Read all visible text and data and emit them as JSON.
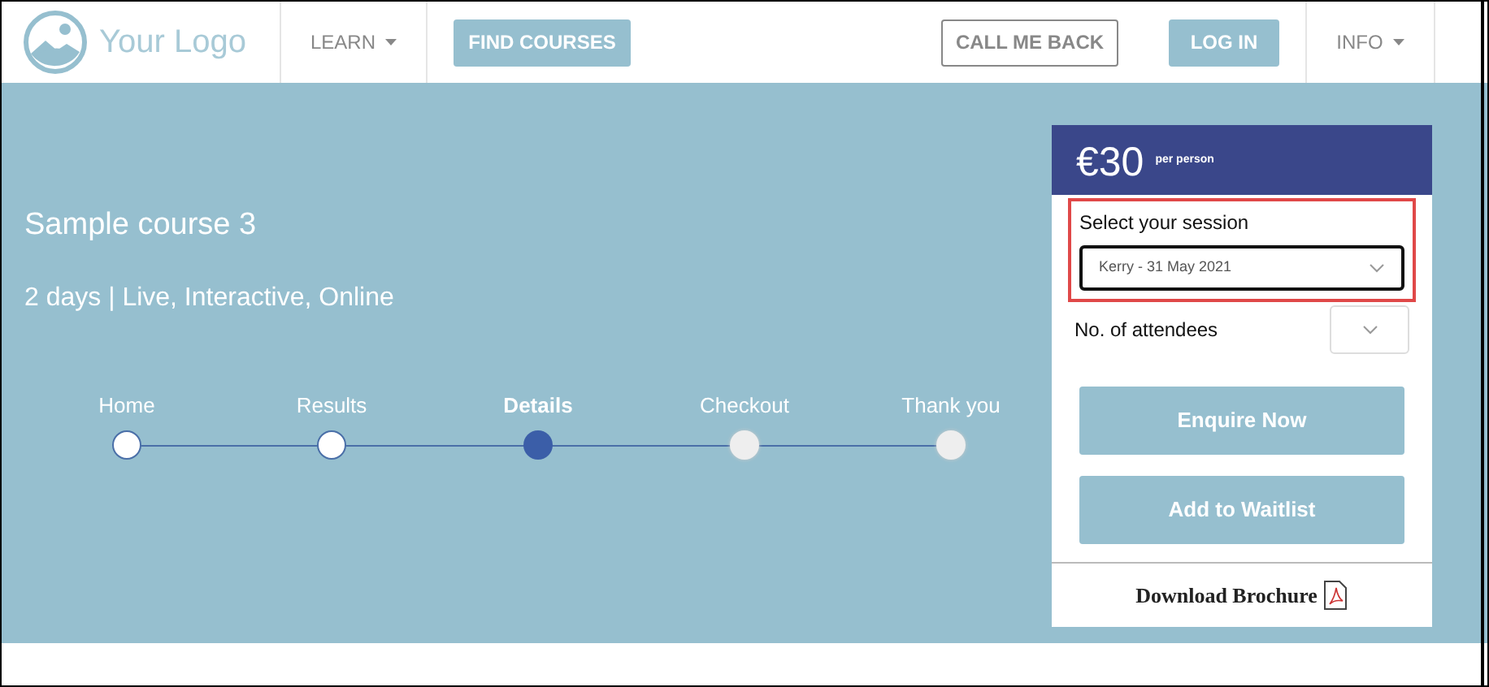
{
  "header": {
    "logo": "Your Logo",
    "nav": [
      {
        "kind": "menu",
        "label": "LEARN"
      },
      {
        "kind": "primary",
        "label": "FIND COURSES"
      },
      {
        "kind": "outline",
        "label": "CALL ME BACK"
      },
      {
        "kind": "primary",
        "label": "LOG IN"
      },
      {
        "kind": "menu",
        "label": "INFO"
      }
    ]
  },
  "course": {
    "title": "Sample course 3",
    "subtitle": "2 days | Live, Interactive, Online"
  },
  "steps": [
    {
      "label": "Home",
      "kind": "done"
    },
    {
      "label": "Results",
      "kind": "done"
    },
    {
      "label": "Details",
      "kind": "current"
    },
    {
      "label": "Checkout",
      "kind": "upcoming"
    },
    {
      "label": "Thank you",
      "kind": "upcoming"
    }
  ],
  "booking": {
    "price": "€30",
    "price_note": "per person",
    "session_label": "Select your session",
    "session_value": "Kerry - 31 May 2021",
    "session_highlighted": true,
    "attendees_label": "No. of attendees",
    "buttons": [
      "Enquire Now",
      "Add to Waitlist"
    ],
    "brochure": "Download Brochure"
  }
}
